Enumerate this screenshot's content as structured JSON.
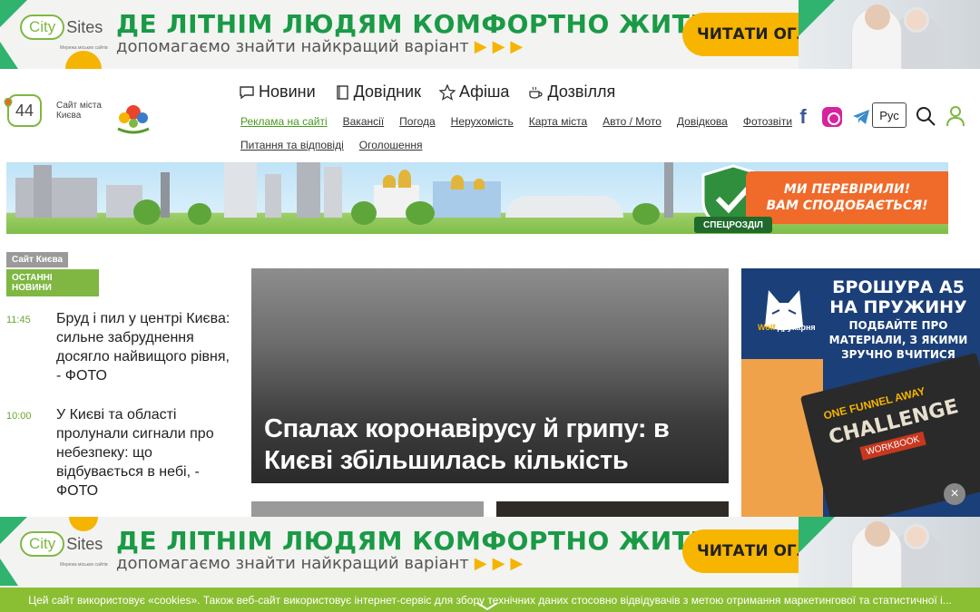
{
  "ad_banner": {
    "logo_city": "City",
    "logo_sites": "Sites",
    "logo_sub": "Мережа міських сайтів",
    "headline": "ДЕ ЛІТНІМ ЛЮДЯМ КОМФОРТНО ЖИТИ",
    "subline": "допомагаємо знайти найкращий варіант",
    "arrows": "▶▶▶",
    "cta": "ЧИТАТИ ОГЛЯД",
    "cta_arrow": "➜"
  },
  "header": {
    "logo_number": "44",
    "logo_label_1": "Сайт міста",
    "logo_label_2": "Києва",
    "main_nav": [
      {
        "label": "Новини",
        "icon": "chat-icon"
      },
      {
        "label": "Довідник",
        "icon": "book-icon"
      },
      {
        "label": "Афіша",
        "icon": "star-icon"
      },
      {
        "label": "Дозвілля",
        "icon": "cup-icon"
      }
    ],
    "sub_nav_row1": [
      "Реклама на сайті",
      "Вакансії",
      "Погода",
      "Нерухомість",
      "Карта міста",
      "Авто / Мото",
      "Довідкова",
      "Фотозвіти"
    ],
    "sub_nav_row2": [
      "Питання та відповіді",
      "Оголошення"
    ],
    "lang": "Рус",
    "social": [
      "facebook-icon",
      "instagram-icon",
      "telegram-icon"
    ]
  },
  "city_banner": {
    "promo_line1": "МИ ПЕРЕВІРИЛИ!",
    "promo_line2": "ВАМ СПОДОБАЄТЬСЯ!",
    "label": "СПЕЦРОЗДІЛ"
  },
  "sidebar": {
    "tag_site": "Сайт Києва",
    "tag_news": "ОСТАННІ НОВИНИ",
    "news": [
      {
        "time": "11:45",
        "title": "Бруд і пил у центрі Києва: сильне забруднення досягло найвищого рівня, - ФОТО"
      },
      {
        "time": "10:00",
        "title": "У Києві та області пролунали сигнали про небезпеку: що відбувається в небі, - ФОТО"
      }
    ]
  },
  "main_story": {
    "headline": "Спалах коронавірусу й грипу: в Києві збільшилась кількість хворих"
  },
  "right_ad": {
    "brand_w": "Wolf",
    "brand": "друкарня",
    "title": "БРОШУРА А5 НА ПРУЖИНУ",
    "text": "ПОДБАЙТЕ ПРО МАТЕРІАЛИ, З ЯКИМИ ЗРУЧНО ВЧИТИСЯ",
    "book_top": "ONE FUNNEL AWAY",
    "book_title": "CHALLENGE",
    "book_label": "WORKBOOK",
    "close": "×"
  },
  "cookie_bar": {
    "text": "Цей сайт використовує «cookies». Також веб-сайт використовує інтернет-сервіс для збору технічних даних стосовно відвідувачів з метою отримання маркетингової та статистичної і..."
  },
  "colors": {
    "brand_green": "#7fb742",
    "headline_green": "#1a9a46",
    "cta_yellow": "#f7b500",
    "cookie_green": "#8bbf33",
    "promo_orange": "#f06a2a"
  }
}
